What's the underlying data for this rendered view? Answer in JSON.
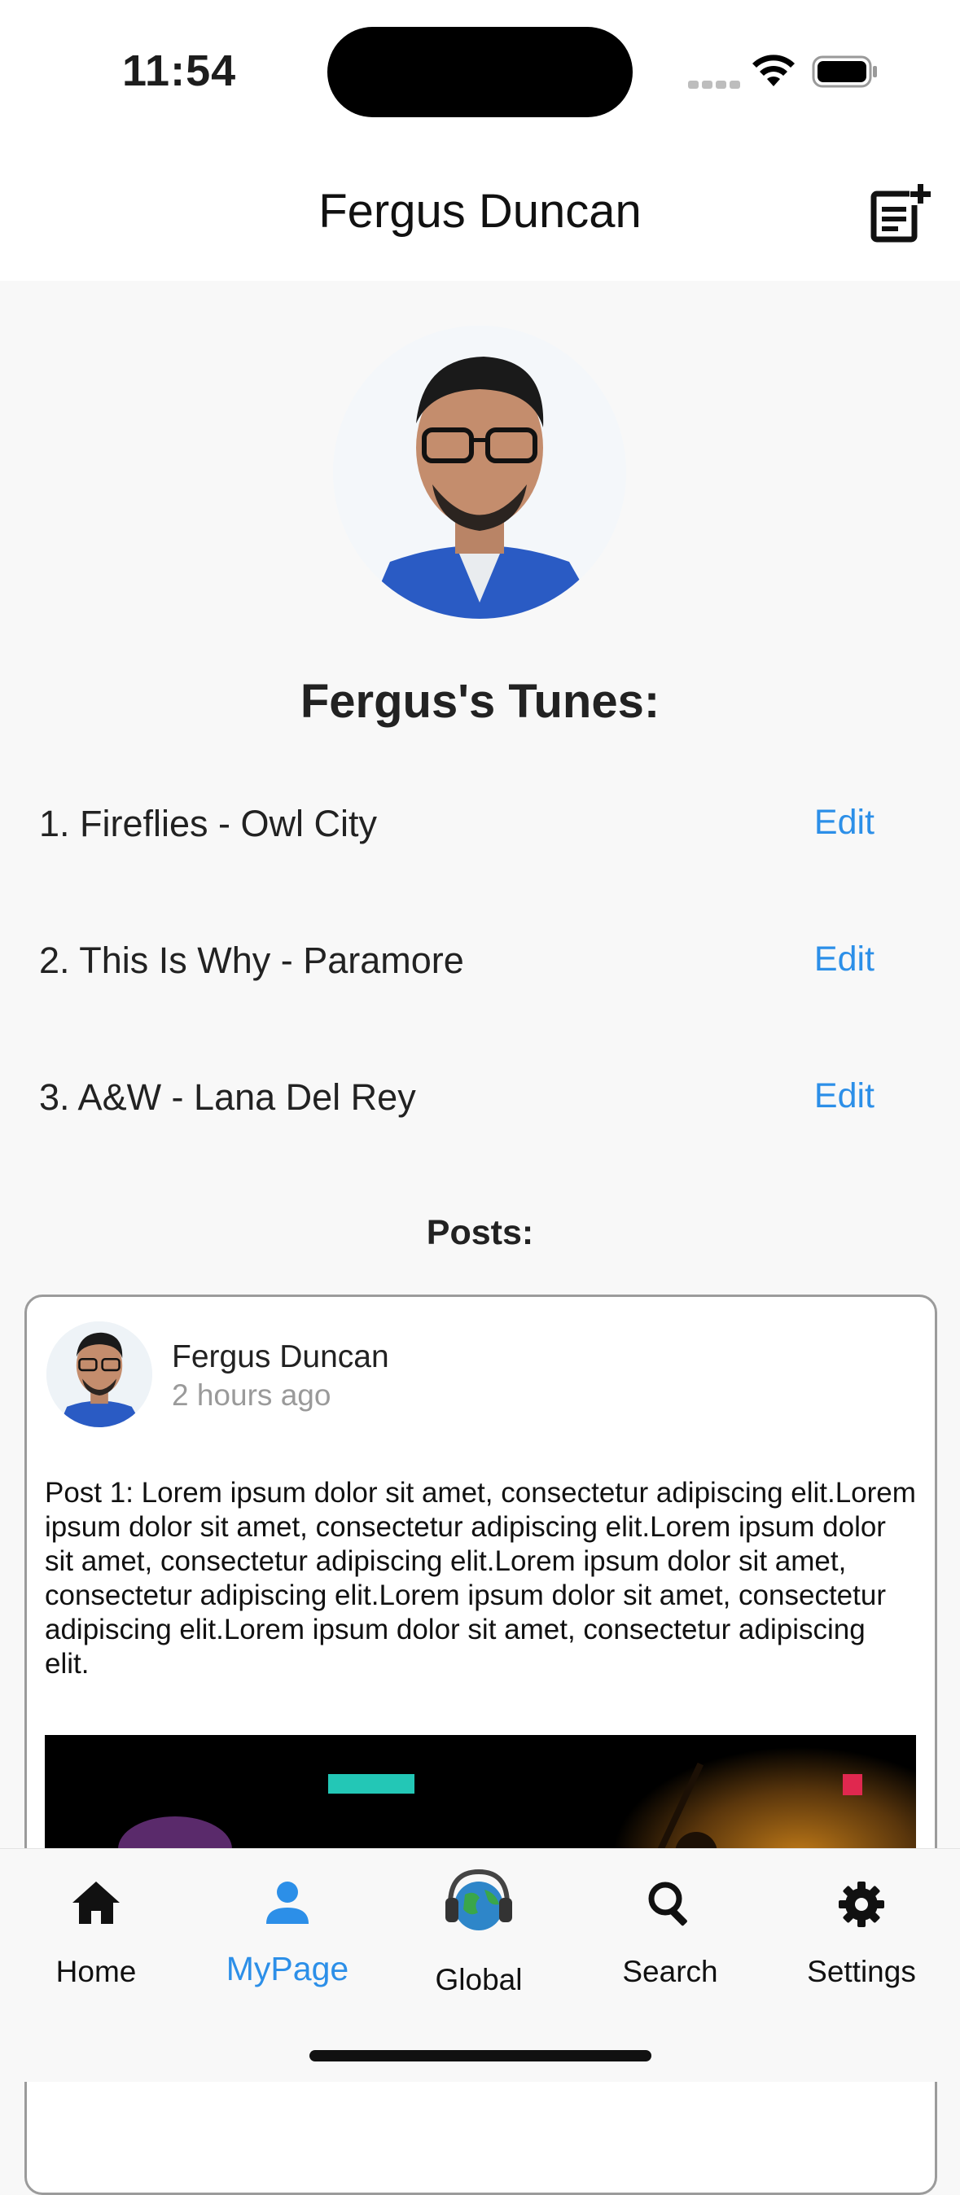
{
  "status_bar": {
    "time": "11:54"
  },
  "header": {
    "title": "Fergus Duncan",
    "new_post_icon": "note-add-icon"
  },
  "profile": {
    "avatar_icon": "profile-photo"
  },
  "tunes": {
    "title": "Fergus's Tunes:",
    "items": [
      {
        "label": "1. Fireflies - Owl City",
        "action": "Edit"
      },
      {
        "label": "2. This Is Why - Paramore",
        "action": "Edit"
      },
      {
        "label": "3. A&W - Lana Del Rey",
        "action": "Edit"
      }
    ]
  },
  "posts": {
    "title": "Posts:",
    "items": [
      {
        "author": "Fergus Duncan",
        "time": "2 hours ago",
        "body": "Post 1: Lorem ipsum dolor sit amet, consectetur adipiscing elit.Lorem ipsum dolor sit amet, consectetur adipiscing elit.Lorem ipsum dolor sit amet, consectetur adipiscing elit.Lorem ipsum dolor sit amet, consectetur adipiscing elit.Lorem ipsum dolor sit amet, consectetur adipiscing elit.Lorem ipsum dolor sit amet, consectetur adipiscing elit."
      }
    ]
  },
  "tab_bar": {
    "tabs": [
      {
        "label": "Home",
        "icon": "home-icon"
      },
      {
        "label": "MyPage",
        "icon": "person-icon",
        "active": true
      },
      {
        "label": "Global",
        "icon": "globe-headphones-icon"
      },
      {
        "label": "Search",
        "icon": "search-icon"
      },
      {
        "label": "Settings",
        "icon": "gear-icon"
      }
    ]
  },
  "colors": {
    "accent": "#2c8fe8",
    "background": "#f8f8f8",
    "header": "#ffffff"
  }
}
